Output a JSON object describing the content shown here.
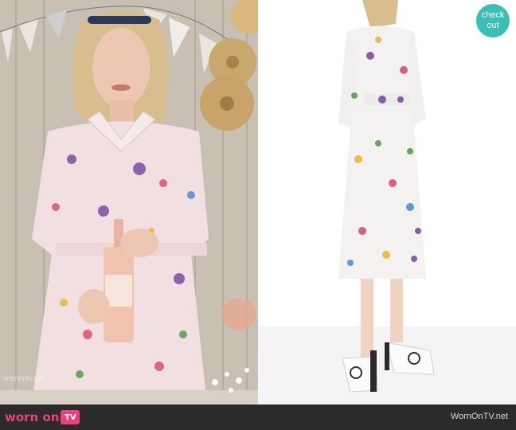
{
  "badge": {
    "line1": "check",
    "line2": "out"
  },
  "watermark": {
    "text": "wornontv.net"
  },
  "footer": {
    "brand": "worn on",
    "tv_label": "TV",
    "site": "WornOnTV.net"
  },
  "colors": {
    "brand_pink": "#e8417b",
    "badge_teal": "#3bbfb2",
    "footer_bg": "#2b2b2b"
  },
  "photos": {
    "left": "actress in floral shirtdress holding wine bottle",
    "right": "product photo of floral shirtdress with white loafers"
  }
}
